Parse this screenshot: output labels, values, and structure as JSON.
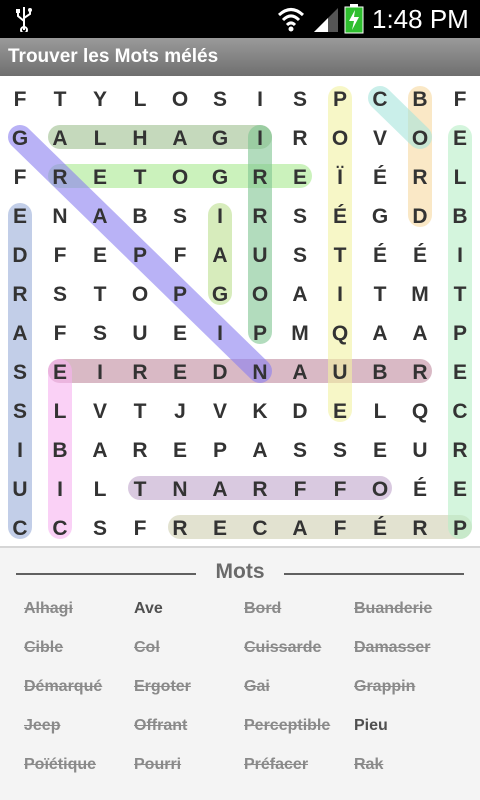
{
  "status_bar": {
    "time": "1:48 PM"
  },
  "app": {
    "title": "Trouver les Mots mélés"
  },
  "grid": {
    "rows": [
      "FTYLOSISPCBF",
      "GALHAGIROVOE",
      "FRETOGREÏÉRL",
      "ENABSIRSÉGDB",
      "DFEPFAUSTÉÉI",
      "RSTOPGOAITMT",
      "AFSUEIPMQAAP",
      "SEIREDNAUBRE",
      "SLVTJVKDELQC",
      "IBAREPASSEUR",
      "UILTNARFFOÉE",
      "CCSFRECAFÉRP"
    ],
    "highlights": [
      {
        "word": "Alhagi",
        "from": [
          1,
          1
        ],
        "to": [
          1,
          6
        ],
        "color": "#9fbf8f"
      },
      {
        "word": "Ergoter",
        "from": [
          2,
          1
        ],
        "to": [
          2,
          7
        ],
        "color": "#a9ea8f"
      },
      {
        "word": "Démarqué",
        "from": [
          0,
          0
        ],
        "to": [
          0,
          0
        ],
        "color": "#000000"
      },
      {
        "word": "Damasser",
        "from": [
          0,
          0
        ],
        "to": [
          0,
          0
        ],
        "color": "#000000"
      },
      {
        "word": "Buanderie",
        "from": [
          7,
          10
        ],
        "to": [
          7,
          1
        ],
        "color": "#c08a9f"
      },
      {
        "word": "Offrant",
        "from": [
          10,
          9
        ],
        "to": [
          10,
          3
        ],
        "color": "#bfa5cc"
      },
      {
        "word": "Préfacer",
        "from": [
          11,
          11
        ],
        "to": [
          11,
          4
        ],
        "color": "#cfcfb0"
      },
      {
        "word": "Grappin",
        "from": [
          1,
          0
        ],
        "to": [
          7,
          6
        ],
        "color": "#8a7ff0"
      },
      {
        "word": "Cuissarde",
        "from": [
          11,
          0
        ],
        "to": [
          3,
          0
        ],
        "color": "#9aaed8"
      },
      {
        "word": "Cible",
        "from": [
          11,
          1
        ],
        "to": [
          7,
          1
        ],
        "color": "#f6b3f0"
      },
      {
        "word": "Gai",
        "from": [
          5,
          5
        ],
        "to": [
          3,
          5
        ],
        "color": "#bde08f"
      },
      {
        "word": "Pourri",
        "from": [
          6,
          6
        ],
        "to": [
          1,
          6
        ],
        "color": "#7fc491"
      },
      {
        "word": "Rak",
        "from": [
          0,
          0
        ],
        "to": [
          0,
          0
        ],
        "color": "#000000"
      },
      {
        "word": "Jeep",
        "from": [
          0,
          0
        ],
        "to": [
          0,
          0
        ],
        "color": "#000000"
      },
      {
        "word": "Poïétique",
        "from": [
          0,
          8
        ],
        "to": [
          8,
          8
        ],
        "color": "#f1f1a2"
      },
      {
        "word": "Bord",
        "from": [
          0,
          10
        ],
        "to": [
          3,
          10
        ],
        "color": "#f7d8a0"
      },
      {
        "word": "Col",
        "from": [
          0,
          9
        ],
        "to": [
          1,
          10
        ],
        "color": "#a6e4dc"
      },
      {
        "word": "Perceptible",
        "from": [
          11,
          11
        ],
        "to": [
          1,
          11
        ],
        "color": "#b7efc6"
      }
    ]
  },
  "words_panel": {
    "heading": "Mots",
    "columns": [
      [
        {
          "label": "Alhagi",
          "found": true
        },
        {
          "label": "Cible",
          "found": true
        },
        {
          "label": "Démarqué",
          "found": true
        },
        {
          "label": "Jeep",
          "found": true
        },
        {
          "label": "Poïétique",
          "found": true
        }
      ],
      [
        {
          "label": "Ave",
          "found": false
        },
        {
          "label": "Col",
          "found": true
        },
        {
          "label": "Ergoter",
          "found": true
        },
        {
          "label": "Offrant",
          "found": true
        },
        {
          "label": "Pourri",
          "found": true
        }
      ],
      [
        {
          "label": "Bord",
          "found": true
        },
        {
          "label": "Cuissarde",
          "found": true
        },
        {
          "label": "Gai",
          "found": true
        },
        {
          "label": "Perceptible",
          "found": true
        },
        {
          "label": "Préfacer",
          "found": true
        }
      ],
      [
        {
          "label": "Buanderie",
          "found": true
        },
        {
          "label": "Damasser",
          "found": true
        },
        {
          "label": "Grappin",
          "found": true
        },
        {
          "label": "Pieu",
          "found": false
        },
        {
          "label": "Rak",
          "found": true
        }
      ]
    ]
  }
}
